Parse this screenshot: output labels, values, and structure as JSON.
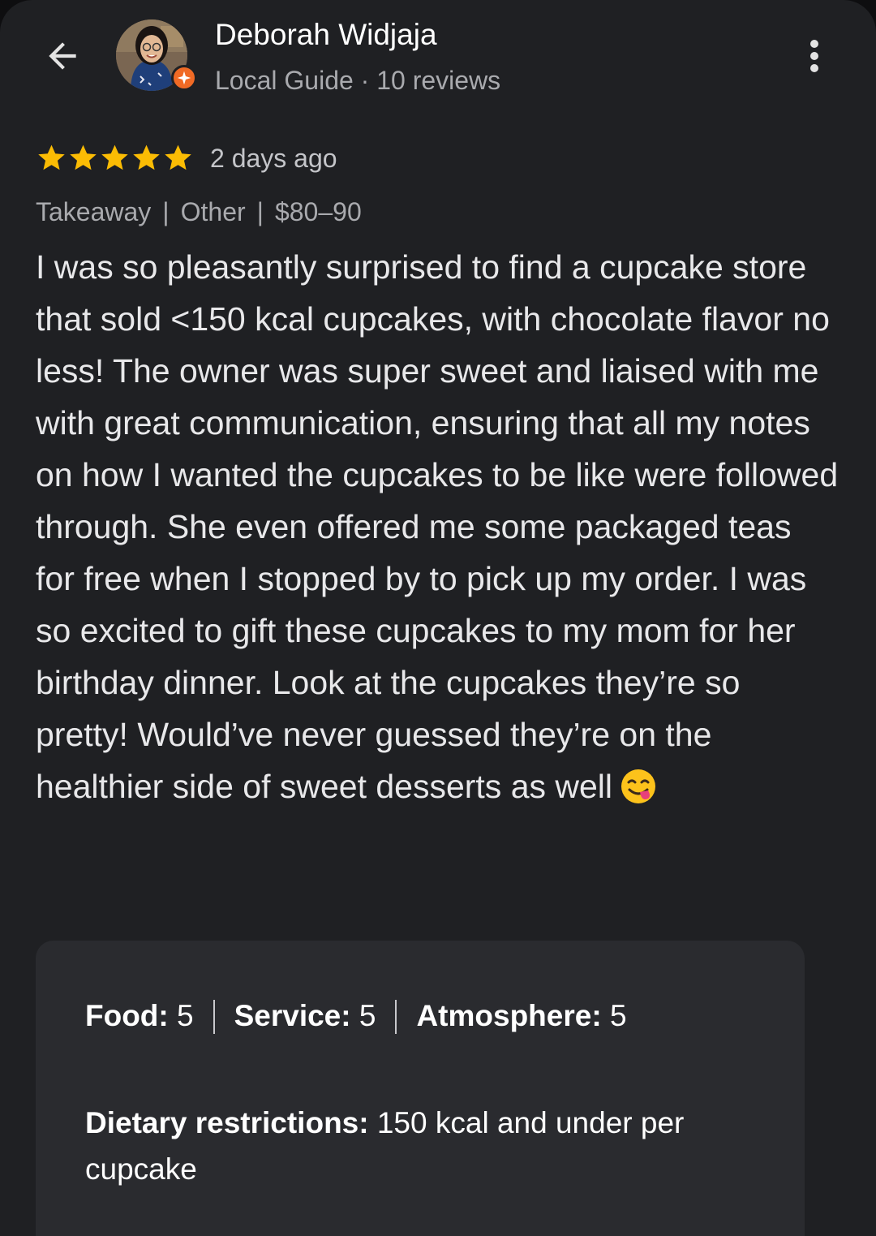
{
  "header": {
    "author_name": "Deborah Widjaja",
    "author_meta": "Local Guide · 10 reviews",
    "back_icon": "arrow-left-icon",
    "more_icon": "more-vert-icon",
    "badge_icon": "local-guide-star-icon"
  },
  "review": {
    "rating": 5,
    "rating_max": 5,
    "date": "2 days ago",
    "tags": [
      "Takeaway",
      "Other",
      "$80–90"
    ],
    "text": "I was so pleasantly surprised to find a cupcake store that sold <150 kcal cupcakes, with chocolate flavor no less! The owner was super sweet and liaised with me with great communication, ensuring that all my notes on how I wanted the cupcakes to be like were followed through. She even offered me some packaged teas for free when I stopped by to pick up my order. I was so excited to gift these cupcakes to my mom for her birthday dinner. Look at the cupcakes they’re so pretty! Would’ve never guessed they’re on the healthier side of sweet desserts as well",
    "emoji": "face-savoring-food-emoji"
  },
  "details": {
    "food_label": "Food:",
    "food_value": "5",
    "service_label": "Service:",
    "service_value": "5",
    "atmosphere_label": "Atmosphere:",
    "atmosphere_value": "5",
    "dietary_label": "Dietary restrictions:",
    "dietary_value": "150 kcal and under per cupcake"
  },
  "colors": {
    "background": "#1f2023",
    "card": "#2a2b2f",
    "star": "#fbbc04",
    "badge": "#f06a25",
    "muted_text": "#a9aaae"
  }
}
